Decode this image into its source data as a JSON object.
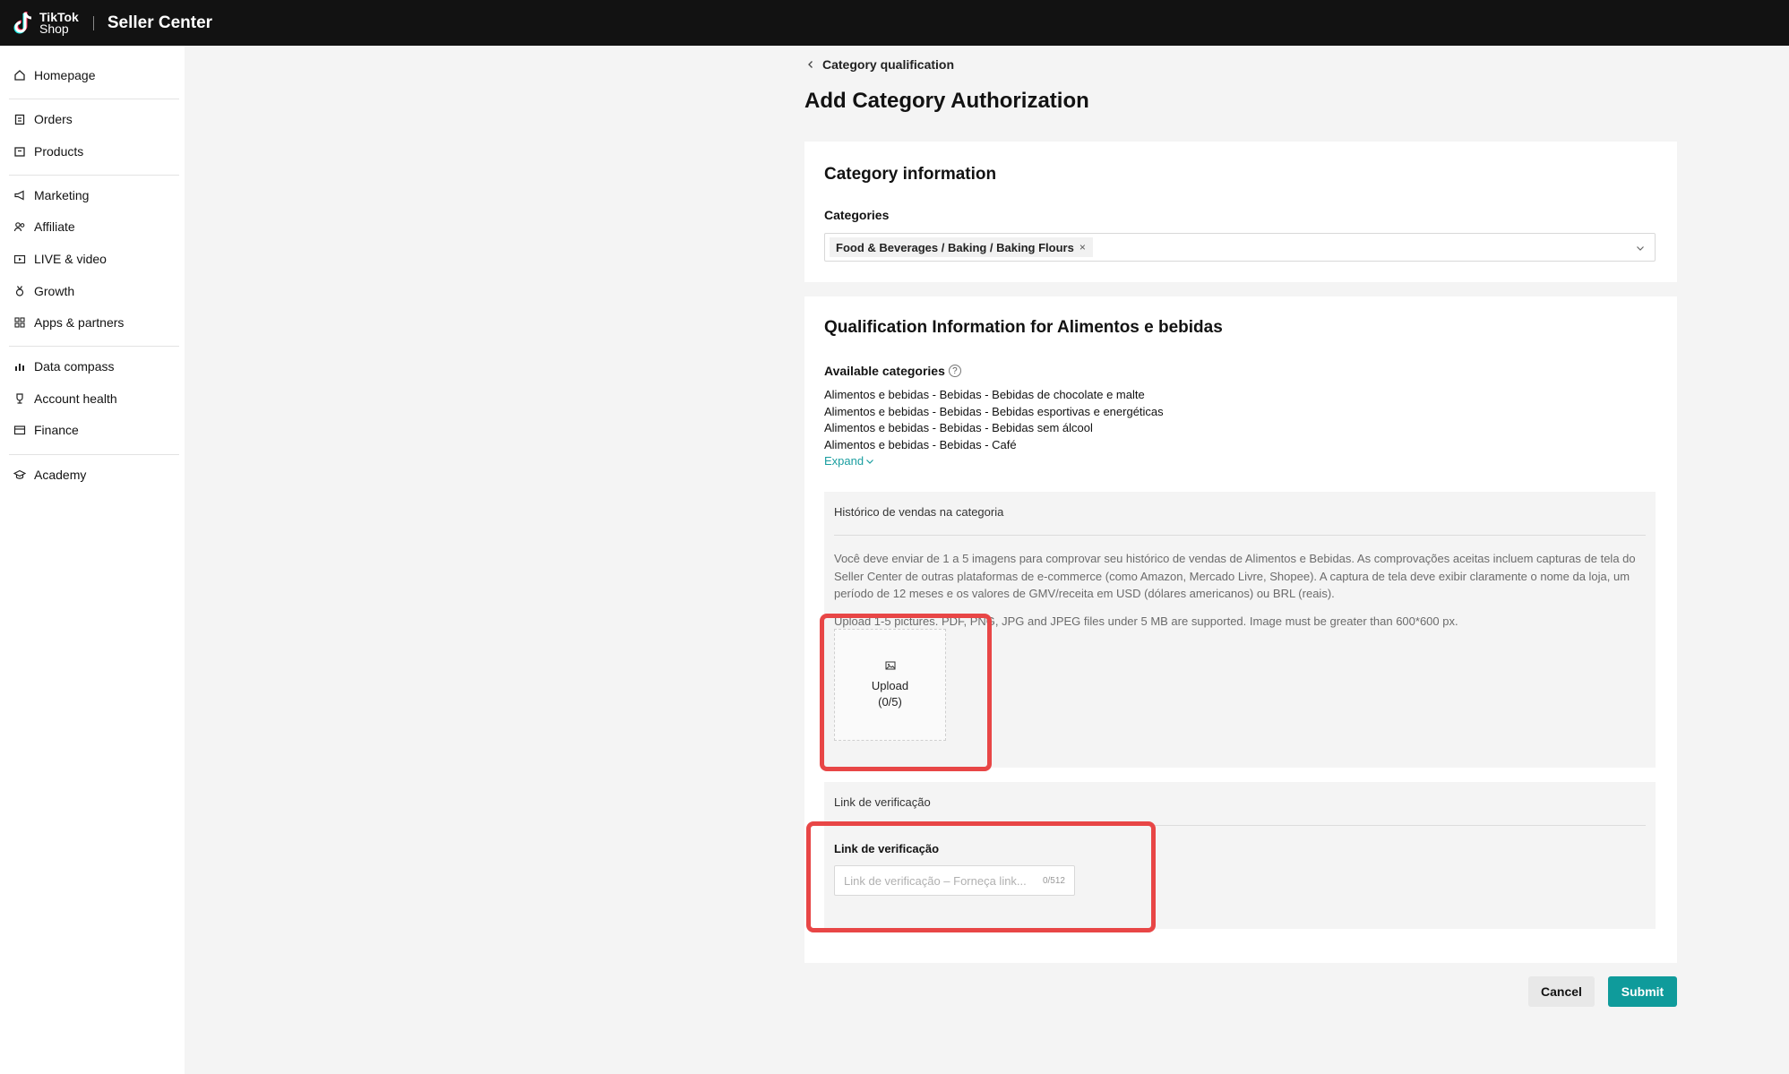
{
  "header": {
    "logo_line1": "TikTok",
    "logo_line2": "Shop",
    "app_title": "Seller Center"
  },
  "sidebar": {
    "items": [
      {
        "label": "Homepage",
        "icon": "home-icon"
      },
      {
        "label": "Orders",
        "icon": "clipboard-icon"
      },
      {
        "label": "Products",
        "icon": "box-icon"
      },
      {
        "label": "Marketing",
        "icon": "megaphone-icon"
      },
      {
        "label": "Affiliate",
        "icon": "users-icon"
      },
      {
        "label": "LIVE & video",
        "icon": "video-icon"
      },
      {
        "label": "Growth",
        "icon": "medal-icon"
      },
      {
        "label": "Apps & partners",
        "icon": "grid-icon"
      },
      {
        "label": "Data compass",
        "icon": "bar-chart-icon"
      },
      {
        "label": "Account health",
        "icon": "trophy-icon"
      },
      {
        "label": "Finance",
        "icon": "wallet-icon"
      },
      {
        "label": "Academy",
        "icon": "graduation-cap-icon"
      }
    ]
  },
  "breadcrumb": {
    "back_label": "Category qualification"
  },
  "page": {
    "title": "Add Category Authorization"
  },
  "category_info": {
    "title": "Category information",
    "categories_label": "Categories",
    "selected_tag": "Food & Beverages / Baking / Baking Flours",
    "remove_symbol": "×"
  },
  "qualification": {
    "title": "Qualification Information for Alimentos e bebidas",
    "available_label": "Available categories",
    "help_symbol": "?",
    "available_categories": [
      "Alimentos e bebidas - Bebidas - Bebidas de chocolate e malte",
      "Alimentos e bebidas - Bebidas - Bebidas esportivas e energéticas",
      "Alimentos e bebidas - Bebidas - Bebidas sem álcool",
      "Alimentos e bebidas - Bebidas - Café"
    ],
    "expand_label": "Expand",
    "sales_history": {
      "title": "Histórico de vendas na categoria",
      "description": "Você deve enviar de 1 a 5 imagens para comprovar seu histórico de vendas de Alimentos e Bebidas. As comprovações aceitas incluem capturas de tela do Seller Center de outras plataformas de e-commerce (como Amazon, Mercado Livre, Shopee). A captura de tela deve exibir claramente o nome da loja, um período de 12 meses e os valores de GMV/receita em USD (dólares americanos) ou BRL (reais).",
      "upload_hint": "Upload 1-5 pictures. PDF, PNG, JPG and JPEG files under 5 MB are supported. Image must be greater than 600*600 px.",
      "upload_label": "Upload",
      "upload_count": "(0/5)"
    },
    "verification": {
      "section_title": "Link de verificação",
      "field_label": "Link de verificação",
      "placeholder": "Link de verificação – Forneça link...",
      "char_count": "0/512"
    }
  },
  "actions": {
    "cancel_label": "Cancel",
    "submit_label": "Submit"
  },
  "colors": {
    "accent": "#0f9b9b",
    "link": "#1a9ea0",
    "highlight": "#e84646",
    "topbar": "#121212"
  }
}
